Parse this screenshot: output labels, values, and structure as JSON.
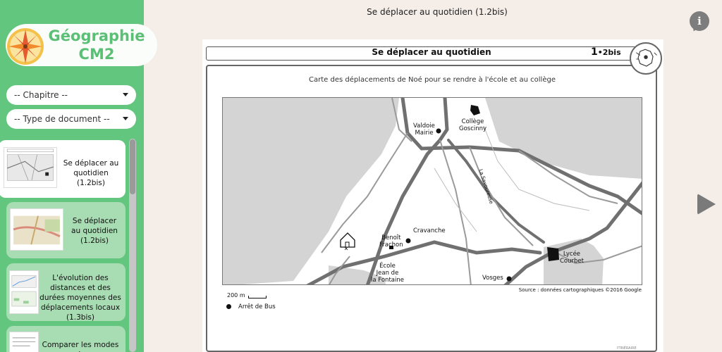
{
  "app": {
    "logo_line1": "Géographie",
    "logo_line2": "CM2",
    "accent": "#62c67e"
  },
  "filters": {
    "chapter": "-- Chapitre --",
    "doc_type": "-- Type de document --"
  },
  "sidebar": {
    "items": [
      {
        "label": "Se déplacer au quotidien (1.2bis)",
        "active": true
      },
      {
        "label": "Se déplacer au quotidien (1.2bis)",
        "active": false
      },
      {
        "label": "L'évolution des distances et des durées moyennes des déplacements locaux (1.3bis)",
        "active": false
      },
      {
        "label": "Comparer les modes de",
        "active": false
      }
    ]
  },
  "header": {
    "title": "Se déplacer au quotidien (1.2bis)",
    "info_icon": "info-icon",
    "next_icon": "next-arrow-icon"
  },
  "document": {
    "heading": "Se déplacer au quotidien",
    "number_main": "1",
    "number_sub": "•2bis",
    "caption": "Carte des déplacements de Noé pour se rendre à l'école et au collège",
    "labels": {
      "valdoie_1": "Valdoie",
      "valdoie_2": "Mairie",
      "college_1": "Collège",
      "college_2": "Goscinny",
      "savoureuse": "La Savoureuse",
      "cravanche": "Cravanche",
      "benoit_1": "Benoît",
      "benoit_2": "Frachon",
      "ecole_1": "École",
      "ecole_2": "Jean de",
      "ecole_3": "la Fontaine",
      "vosges": "Vosges",
      "lycee_1": "Lycée",
      "lycee_2": "Courbet"
    },
    "scale": "200 m",
    "source": "Source : données cartographiques ©2016 Google",
    "legend": "Arrêt de Bus",
    "footer": "ITINÉRAIRE"
  }
}
